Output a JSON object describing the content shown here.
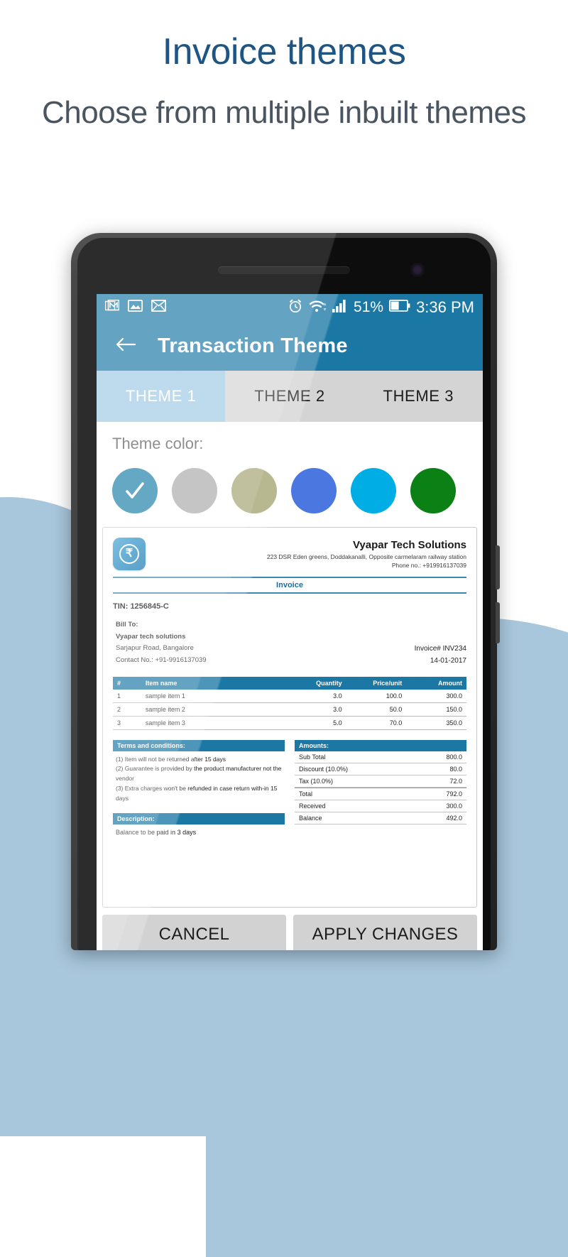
{
  "promo": {
    "title": "Invoice themes",
    "subtitle": "Choose from multiple inbuilt themes",
    "title_color": "#1f5582",
    "subtitle_color": "#4a5560",
    "wave_color": "#a8c6dc"
  },
  "status_bar": {
    "icons_left": [
      "gmail-icon",
      "photos-icon",
      "mail-icon"
    ],
    "alarm_icon": "alarm-icon",
    "wifi_icon": "wifi-icon",
    "signal_icon": "signal-bars-icon",
    "battery_percent": "51%",
    "battery_icon": "battery-icon",
    "time": "3:36 PM",
    "background": "#1b78a5"
  },
  "app_bar": {
    "back_icon": "back-arrow-icon",
    "title": "Transaction Theme",
    "background": "#1b78a5"
  },
  "tabs": [
    {
      "label": "THEME 1",
      "active": true
    },
    {
      "label": "THEME 2",
      "active": false
    },
    {
      "label": "THEME 3",
      "active": false
    }
  ],
  "theme_color": {
    "label": "Theme color:",
    "selected_index": 0,
    "check_icon": "check-icon",
    "swatches": [
      {
        "name": "teal-blue",
        "hex": "#1b7fa8",
        "selected": true
      },
      {
        "name": "gray",
        "hex": "#aaaaaa",
        "selected": false
      },
      {
        "name": "olive",
        "hex": "#a3a371",
        "selected": false
      },
      {
        "name": "royal-blue",
        "hex": "#4a78e0",
        "selected": false
      },
      {
        "name": "cyan",
        "hex": "#00ade5",
        "selected": false
      },
      {
        "name": "dark-green",
        "hex": "#0a8015",
        "selected": false
      },
      {
        "name": "light-green",
        "hex": "#8cc43c",
        "selected": false
      },
      {
        "name": "maroon",
        "hex": "#6b2414",
        "selected": false
      }
    ]
  },
  "invoice": {
    "logo_icon": "rupee-coin-logo",
    "logo_symbol": "₹",
    "company": "Vyapar Tech Solutions",
    "address": "223 DSR Eden greens, Doddakanalli, Opposite carmelaram railway station",
    "phone": "Phone no.: +919916137039",
    "doc_type": "Invoice",
    "tin": "TIN: 1256845-C",
    "bill_to_label": "Bill To:",
    "bill_to_name": "Vyapar tech solutions",
    "bill_to_address": "Sarjapur Road, Bangalore",
    "bill_to_contact": "Contact No.: +91-9916137039",
    "invoice_number": "Invoice# INV234",
    "invoice_date": "14-01-2017",
    "table": {
      "headers": [
        "#",
        "Item name",
        "Quantity",
        "Price/unit",
        "Amount"
      ],
      "rows": [
        [
          "1",
          "sample item 1",
          "3.0",
          "100.0",
          "300.0"
        ],
        [
          "2",
          "sample item 2",
          "3.0",
          "50.0",
          "150.0"
        ],
        [
          "3",
          "sample item 3",
          "5.0",
          "70.0",
          "350.0"
        ]
      ]
    },
    "terms_title": "Terms and conditions:",
    "terms": [
      "(1) Item will not be returned after 15 days",
      "(2) Guarantee is provided by the product manufacturer not the vendor",
      "(3) Extra charges won't be refunded in case return with-in 15 days"
    ],
    "description_title": "Description:",
    "description": "Balance to be paid in 3 days",
    "amounts_title": "Amounts:",
    "amounts": [
      {
        "label": "Sub Total",
        "value": "800.0"
      },
      {
        "label": "Discount (10.0%)",
        "value": "80.0"
      },
      {
        "label": "Tax (10.0%)",
        "value": "72.0"
      },
      {
        "label": "Total",
        "value": "792.0"
      },
      {
        "label": "Received",
        "value": "300.0"
      },
      {
        "label": "Balance",
        "value": "492.0"
      }
    ]
  },
  "actions": {
    "cancel_label": "CANCEL",
    "apply_label": "APPLY CHANGES"
  }
}
